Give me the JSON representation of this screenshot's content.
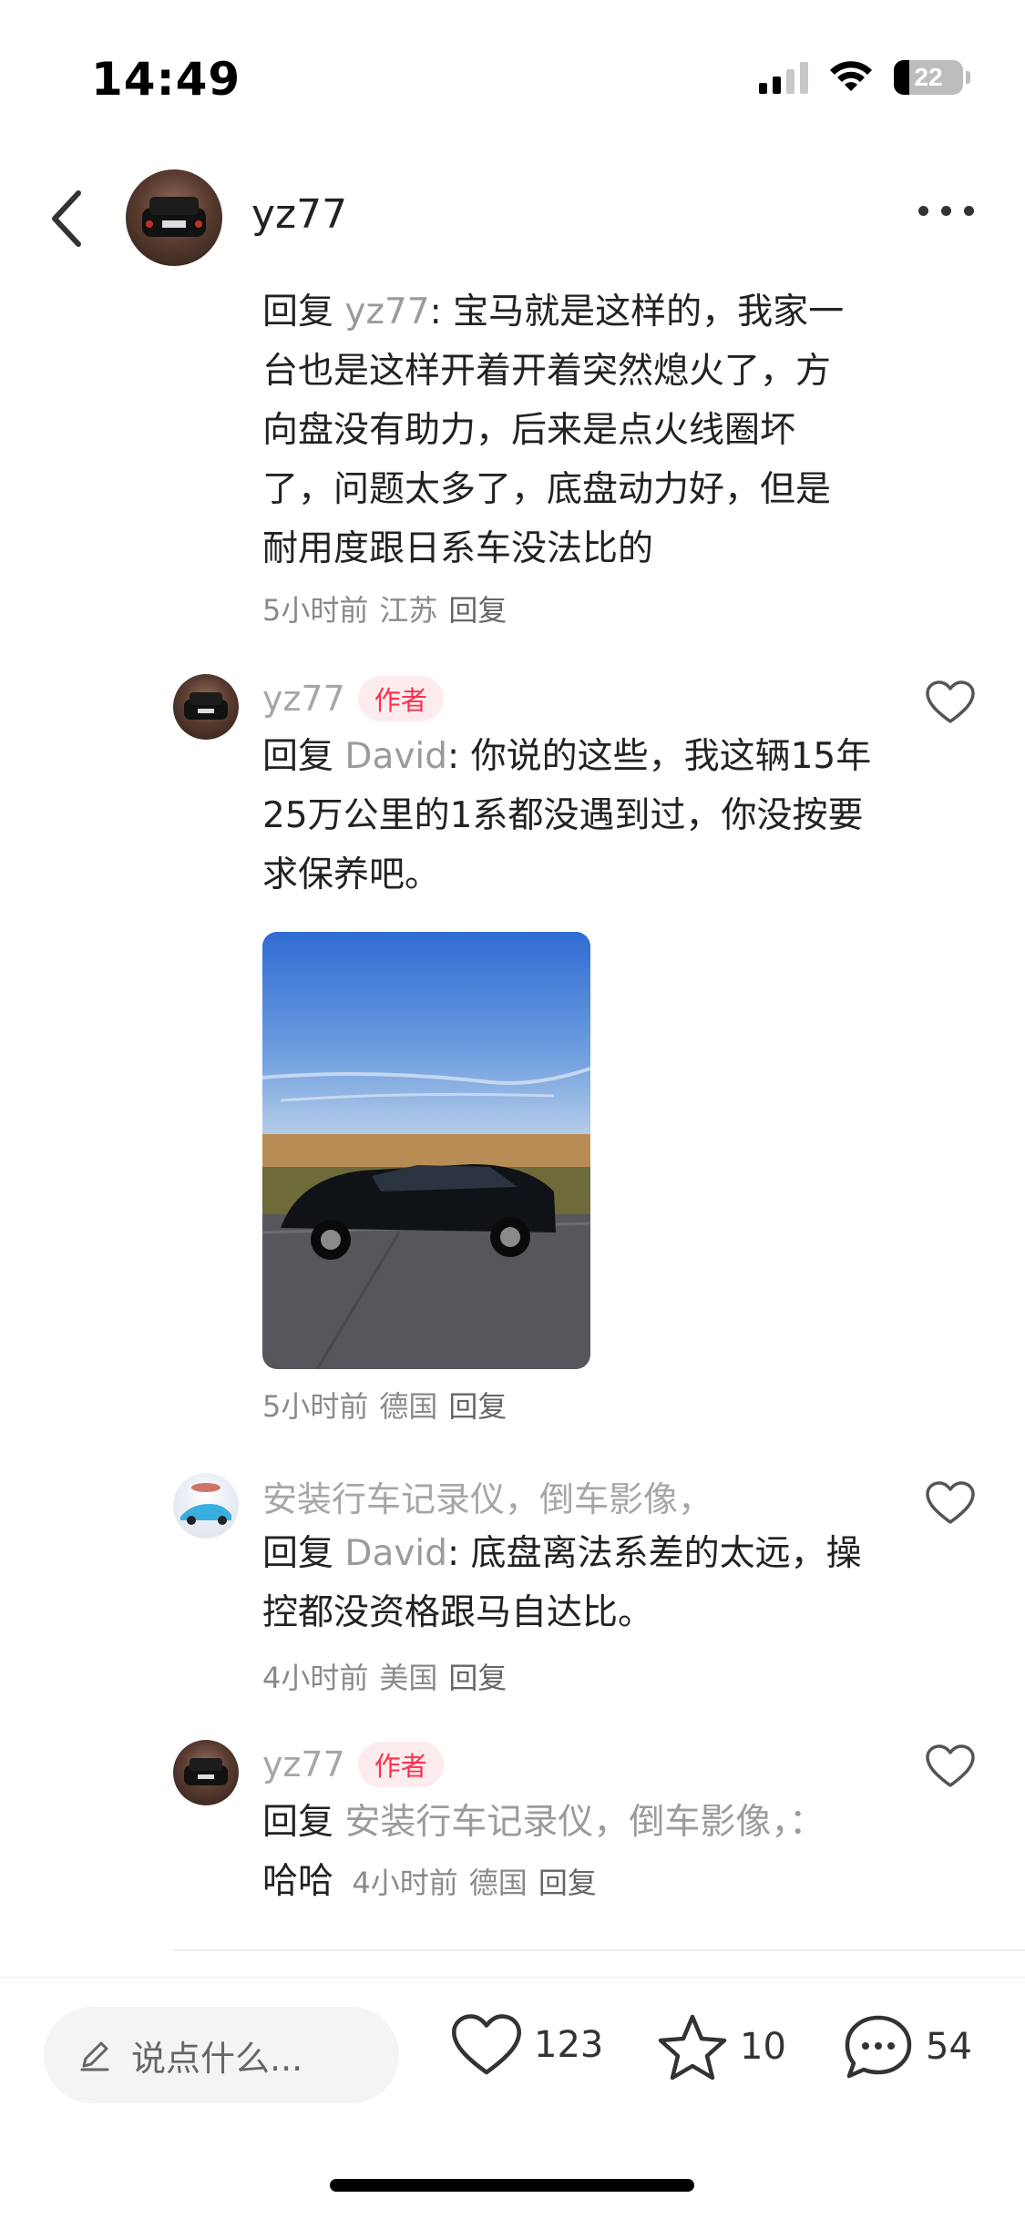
{
  "status_bar": {
    "time": "14:49",
    "battery": "22"
  },
  "header": {
    "username": "yz77"
  },
  "comments": [
    {
      "reply_word": "回复",
      "mention": "yz77",
      "text": ": 宝马就是这样的，我家一台也是这样开着开着突然熄火了，方向盘没有助力，后来是点火线圈坏了，问题太多了，底盘动力好，但是耐用度跟日系车没法比的",
      "time": "5小时前",
      "location": "江苏",
      "reply_label": "回复"
    },
    {
      "name": "yz77",
      "badge": "作者",
      "reply_word": "回复",
      "mention": "David",
      "text": ": 你说的这些，我这辆15年25万公里的1系都没遇到过，你没按要求保养吧。",
      "time": "5小时前",
      "location": "德国",
      "reply_label": "回复"
    },
    {
      "name": "安装行车记录仪，倒车影像，",
      "reply_word": "回复",
      "mention": "David",
      "text": ": 底盘离法系差的太远，操控都没资格跟马自达比。",
      "time": "4小时前",
      "location": "美国",
      "reply_label": "回复"
    },
    {
      "name": "yz77",
      "badge": "作者",
      "reply_word": "回复",
      "mention": "安装行车记录仪，倒车影像，",
      "text_colon": "：",
      "text": "哈哈",
      "time": "4小时前",
      "location": "德国",
      "reply_label": "回复"
    }
  ],
  "bottom_bar": {
    "input_placeholder": "说点什么...",
    "likes": "123",
    "favorites": "10",
    "comments": "54"
  }
}
